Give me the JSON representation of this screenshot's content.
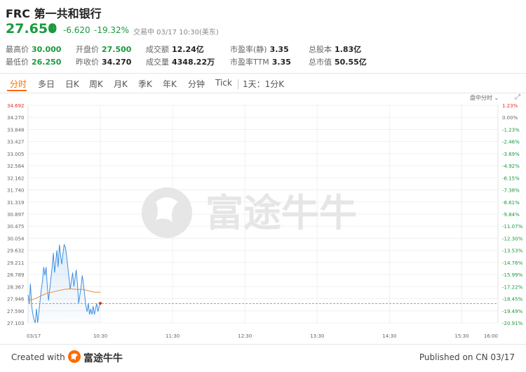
{
  "header": {
    "title": "FRC 第一共和银行",
    "price": "27.650",
    "change": "-6.620",
    "change_pct": "-19.32%",
    "status": "交易中 03/17 10:30(美东)"
  },
  "stats": [
    {
      "label": "最高价",
      "value": "30.000",
      "color": "green"
    },
    {
      "label": "开盘价",
      "value": "27.500",
      "color": "green"
    },
    {
      "label": "成交额",
      "value": "12.24亿",
      "color": "normal"
    },
    {
      "label": "市盈率(静)",
      "value": "3.35",
      "color": "normal"
    },
    {
      "label": "总股本",
      "value": "1.83亿",
      "color": "normal"
    },
    {
      "label": "最低价",
      "value": "26.250",
      "color": "green"
    },
    {
      "label": "昨收价",
      "value": "34.270",
      "color": "normal"
    },
    {
      "label": "成交量",
      "value": "4348.22万",
      "color": "normal"
    },
    {
      "label": "市盈率TTM",
      "value": "3.35",
      "color": "normal"
    },
    {
      "label": "总市值",
      "value": "50.55亿",
      "color": "normal"
    }
  ],
  "tabs": [
    "分时",
    "多日",
    "日K",
    "周K",
    "月K",
    "季K",
    "年K",
    "分钟",
    "Tick",
    "1天：1分K"
  ],
  "active_tab": "分时",
  "chart_mode": "盘中分时",
  "watermark": "富途牛牛",
  "footer": {
    "created_with": "Created with",
    "brand": "富途牛牛",
    "published": "Published on CN 03/17"
  },
  "colors": {
    "down": "#1a9a3e",
    "up": "#e0302c",
    "accent": "#ff6a00",
    "price_line": "#3d8fe0",
    "avg_line": "#e88a3c"
  },
  "chart_data": {
    "type": "line",
    "title": "",
    "x_ticks": [
      "03/17",
      "10:30",
      "11:30",
      "12:30",
      "13:30",
      "14:30",
      "15:30",
      "16:00"
    ],
    "y_ticks": [
      "34.692",
      "34.270",
      "33.848",
      "33.427",
      "33.005",
      "32.584",
      "32.162",
      "31.740",
      "31.319",
      "30.897",
      "30.475",
      "30.054",
      "29.632",
      "29.211",
      "28.789",
      "28.367",
      "27.946",
      "27.590",
      "27.103"
    ],
    "pct_ticks": [
      "1.23%",
      "0.00%",
      "-1.23%",
      "-2.46%",
      "-3.69%",
      "-4.92%",
      "-6.15%",
      "-7.38%",
      "-8.61%",
      "-9.84%",
      "-11.07%",
      "-12.30%",
      "-13.53%",
      "-14.76%",
      "-15.99%",
      "-17.22%",
      "-18.45%",
      "-19.49%",
      "-20.91%"
    ],
    "ylim": [
      26.9,
      34.692
    ],
    "x_range_minutes": [
      0,
      390
    ],
    "current_price": 27.59,
    "series": [
      {
        "x": [
          0,
          1,
          2,
          3,
          4,
          5,
          6,
          7,
          8,
          9,
          10,
          11,
          12,
          13,
          14,
          15,
          16,
          17,
          18,
          19,
          20,
          21,
          22,
          23,
          24,
          25,
          26,
          27,
          28,
          29,
          30,
          31,
          32,
          33,
          34,
          35,
          36,
          37,
          38,
          39,
          40,
          41,
          42,
          43,
          44,
          45,
          46,
          47,
          48,
          49,
          50,
          51,
          52,
          53,
          54,
          55,
          56,
          57,
          58,
          59,
          60
        ],
        "y": [
          27.9,
          27.6,
          28.3,
          27.5,
          27.2,
          27.0,
          26.9,
          27.4,
          26.9,
          27.3,
          27.7,
          28.1,
          28.4,
          28.9,
          28.6,
          28.9,
          28.2,
          27.7,
          28.1,
          28.5,
          28.9,
          29.4,
          28.7,
          29.1,
          29.5,
          28.9,
          29.7,
          29.3,
          29.0,
          29.4,
          29.7,
          29.6,
          29.3,
          28.9,
          28.5,
          28.1,
          28.4,
          28.7,
          28.2,
          28.5,
          28.8,
          28.3,
          27.6,
          27.9,
          28.2,
          28.6,
          28.3,
          27.9,
          27.5,
          27.3,
          27.6,
          27.2,
          27.4,
          27.2,
          27.5,
          27.2,
          27.4,
          27.6,
          27.3,
          27.5,
          27.6
        ]
      },
      {
        "x": [
          0,
          5,
          10,
          15,
          20,
          25,
          30,
          35,
          40,
          45,
          50,
          55,
          60
        ],
        "y": [
          27.7,
          27.75,
          27.85,
          27.95,
          28.0,
          28.05,
          28.1,
          28.12,
          28.1,
          28.1,
          28.05,
          28.0,
          28.0
        ]
      }
    ]
  }
}
